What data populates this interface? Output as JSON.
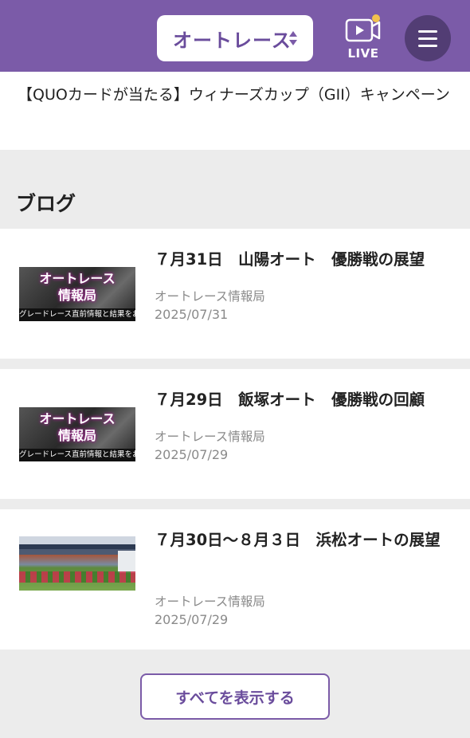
{
  "header": {
    "race_select_label": "オートレース",
    "live_label": "LIVE",
    "accent_color": "#7b5ba8",
    "live_dot_color": "#f2c14e"
  },
  "campaign": {
    "text": "【QUOカードが当たる】ウィナーズカップ（GII）キャンペーン"
  },
  "blog": {
    "section_title": "ブログ",
    "thumbnail_title_line1": "オートレース",
    "thumbnail_title_line2": "情報局",
    "thumbnail_strip": "グレードレース直前情報と結果をお届け",
    "items": [
      {
        "title": "７月31日　山陽オート　優勝戦の展望",
        "source": "オートレース情報局",
        "date": "2025/07/31",
        "thumbnail": "info-bureau-banner"
      },
      {
        "title": "７月29日　飯塚オート　優勝戦の回顧",
        "source": "オートレース情報局",
        "date": "2025/07/29",
        "thumbnail": "info-bureau-banner"
      },
      {
        "title": "７月30日～８月３日　浜松オートの展望",
        "source": "オートレース情報局",
        "date": "2025/07/29",
        "thumbnail": "stadium-photo"
      }
    ],
    "view_all_label": "すべてを表示する"
  }
}
